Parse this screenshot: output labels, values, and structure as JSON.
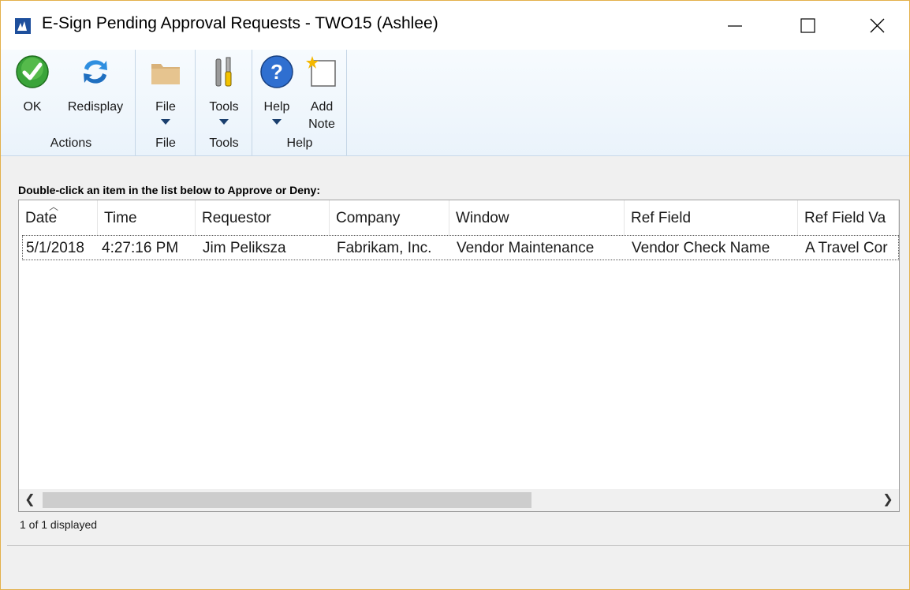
{
  "window": {
    "title": "E-Sign Pending Approval Requests  -  TWO15 (Ashlee)"
  },
  "ribbon": {
    "groups": [
      {
        "label": "Actions",
        "buttons": [
          {
            "label": "OK",
            "icon": "ok-check-icon"
          },
          {
            "label": "Redisplay",
            "icon": "refresh-icon"
          }
        ]
      },
      {
        "label": "File",
        "buttons": [
          {
            "label": "File",
            "icon": "folder-icon"
          }
        ]
      },
      {
        "label": "Tools",
        "buttons": [
          {
            "label": "Tools",
            "icon": "tools-icon"
          }
        ]
      },
      {
        "label": "Help",
        "buttons": [
          {
            "label": "Help",
            "icon": "help-icon"
          },
          {
            "label": "Add\nNote",
            "icon": "note-icon"
          }
        ]
      }
    ]
  },
  "list": {
    "instruction": "Double-click an item in the list below to Approve or Deny:",
    "columns": [
      "Date",
      "Time",
      "Requestor",
      "Company",
      "Window",
      "Ref Field",
      "Ref Field Va"
    ],
    "rows": [
      [
        "5/1/2018",
        "4:27:16 PM",
        "Jim Peliksza",
        "Fabrikam, Inc.",
        "Vendor Maintenance",
        "Vendor Check Name",
        "A Travel Cor"
      ]
    ],
    "sorted_column": "Date"
  },
  "status": {
    "text": "1 of 1 displayed"
  },
  "colors": {
    "ribbon_bg": "#eaf3fb",
    "app_icon": "#1e4f9c",
    "window_border": "#e3b04b"
  }
}
